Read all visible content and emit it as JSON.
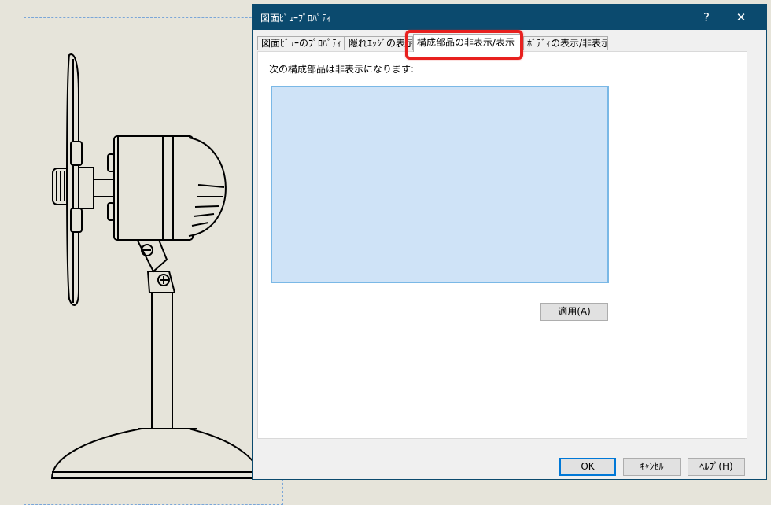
{
  "dialog": {
    "title": "図面ﾋﾞｭｰﾌﾟﾛﾊﾟﾃｨ",
    "help_button": "?",
    "close_button": "✕",
    "tabs": [
      {
        "label": "図面ﾋﾞｭｰのﾌﾟﾛﾊﾟﾃｨ"
      },
      {
        "label": "隠れｴｯｼﾞの表示"
      },
      {
        "label": "構成部品の非表示/表示",
        "active": true
      },
      {
        "label": "ﾎﾞﾃﾞｨの表示/非表示"
      }
    ],
    "panel": {
      "label": "次の構成部品は非表示になります:",
      "apply_button": "適用(A)"
    },
    "footer": {
      "ok_button": "OK",
      "cancel_button": "ｷｬﾝｾﾙ",
      "help_button": "ﾍﾙﾌﾟ(H)"
    }
  },
  "colors": {
    "titlebar": "#0b4a6e",
    "highlight": "#e8201e",
    "listbox_fill": "#cfe3f7",
    "listbox_border": "#7ab8e6",
    "background": "#e6e4da"
  },
  "drawing": {
    "subject": "desk fan drawing view"
  }
}
